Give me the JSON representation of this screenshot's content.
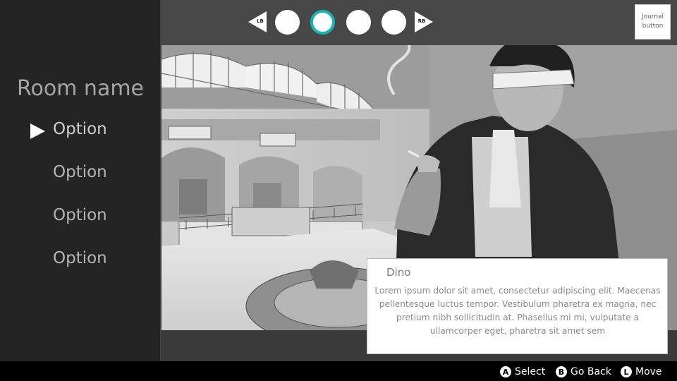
{
  "room": {
    "name": "Room name"
  },
  "menu": {
    "items": [
      {
        "label": "Option",
        "selected": true
      },
      {
        "label": "Option",
        "selected": false
      },
      {
        "label": "Option",
        "selected": false
      },
      {
        "label": "Option",
        "selected": false
      }
    ]
  },
  "pager": {
    "left_shoulder": "LB",
    "right_shoulder": "RB",
    "page_count": 4,
    "active_index": 1,
    "active_color": "#19b3b3"
  },
  "journal": {
    "label": "Journal button"
  },
  "scene": {
    "description_icon": "illustration",
    "palette": [
      "#ffffff",
      "#d9d9d9",
      "#9a9a9a",
      "#555555",
      "#1f1f1f"
    ]
  },
  "dialogue": {
    "speaker": "Dino",
    "text": "Lorem ipsum dolor sit amet, consectetur adipiscing elit. Maecenas pellentesque luctus tempor. Vestibulum pharetra ex magna, nec pretium nibh sollicitudin at. Phasellus mi mi, vulputate a ullamcorper eget, pharetra sit amet sem"
  },
  "footer": {
    "hints": [
      {
        "button": "A",
        "label": "Select"
      },
      {
        "button": "B",
        "label": "Go Back"
      },
      {
        "button": "L",
        "label": "Move"
      }
    ]
  }
}
